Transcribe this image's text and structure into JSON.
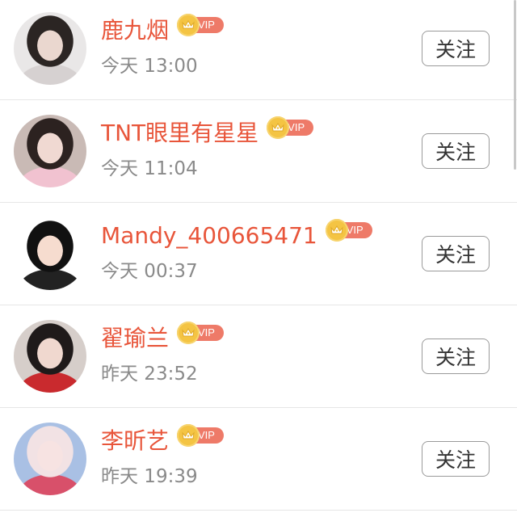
{
  "users": [
    {
      "name": "鹿九烟",
      "badge": "VIP",
      "time": "今天 13:00",
      "follow_label": "关注",
      "avatar_colors": {
        "c1": "#e9e7e7",
        "c2": "#2b2523",
        "c3": "#ead7cf",
        "c4": "#d6d1d1"
      }
    },
    {
      "name": "TNT眼里有星星",
      "badge": "VIP",
      "time": "今天 11:04",
      "follow_label": "关注",
      "avatar_colors": {
        "c1": "#c9bab5",
        "c2": "#2c2220",
        "c3": "#f0d9d2",
        "c4": "#f1c2d0"
      }
    },
    {
      "name": "Mandy_400665471",
      "badge": "VIP",
      "time": "今天 00:37",
      "follow_label": "关注",
      "avatar_colors": {
        "c1": "#ffffff",
        "c2": "#111111",
        "c3": "#f6dccf",
        "c4": "#222222"
      }
    },
    {
      "name": "翟瑜兰",
      "badge": "VIP",
      "time": "昨天 23:52",
      "follow_label": "关注",
      "avatar_colors": {
        "c1": "#d6ceca",
        "c2": "#1f1a1a",
        "c3": "#f0d8cf",
        "c4": "#c92a2e"
      }
    },
    {
      "name": "李昕艺",
      "badge": "VIP",
      "time": "昨天 19:39",
      "follow_label": "关注",
      "avatar_colors": {
        "c1": "#a9c0e4",
        "c2": "#f2e2e4",
        "c3": "#f7e3e2",
        "c4": "#d8506a"
      }
    }
  ],
  "colors": {
    "name": "#e8553a",
    "time": "#8a8a8a",
    "vip_crown": "#f4c443",
    "vip_pill": "#ee7a68",
    "divider": "#e6e6e6",
    "button_border": "#9a9a9a"
  },
  "icons": {
    "vip": "crown-icon"
  }
}
